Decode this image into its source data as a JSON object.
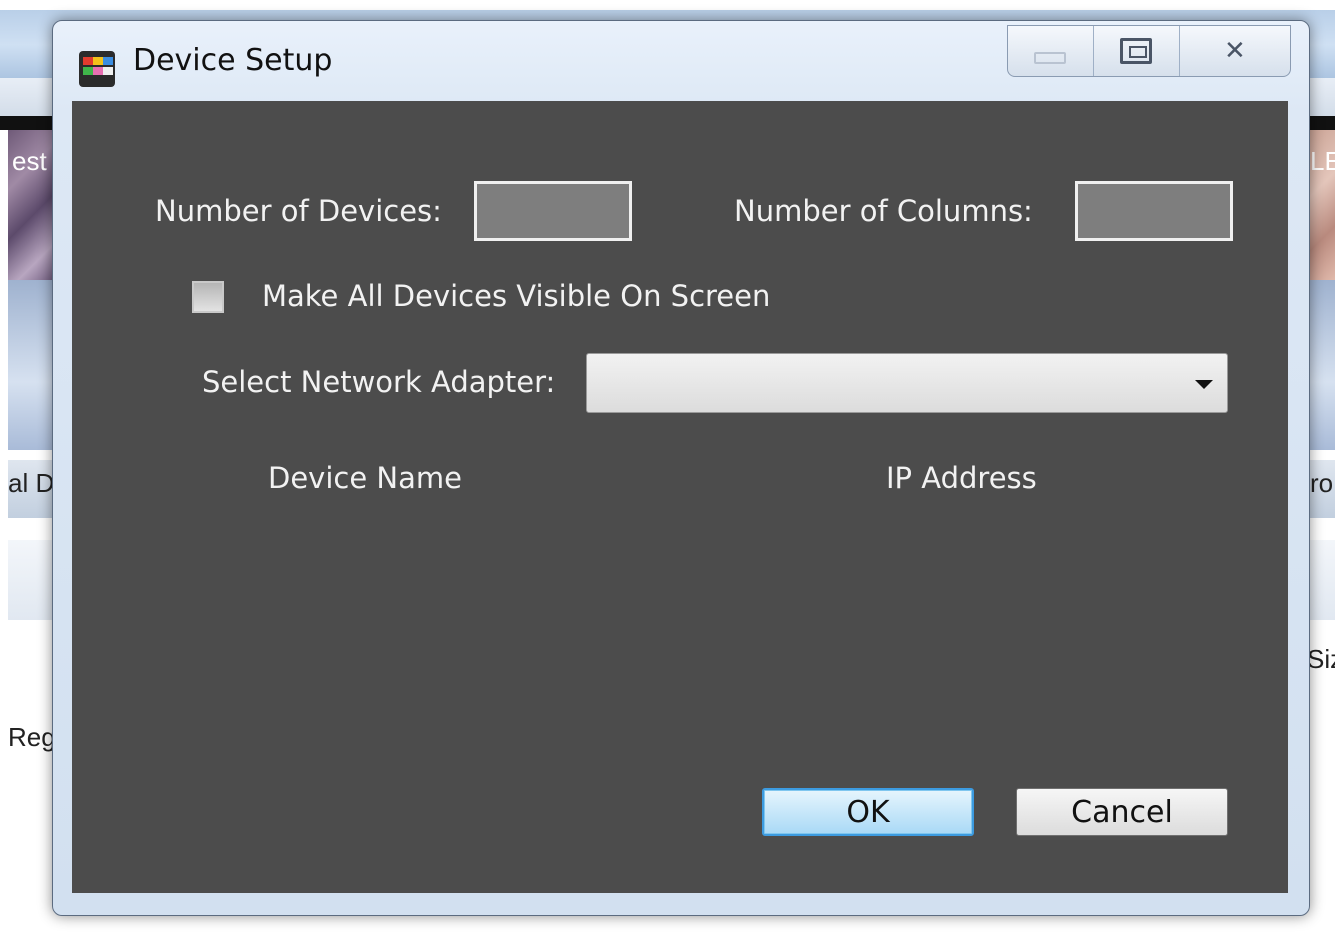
{
  "background": {
    "fragments": [
      "est",
      "al D",
      "Reg",
      "LE",
      "ro",
      "Siz"
    ]
  },
  "dialog": {
    "title": "Device Setup",
    "icon": "app-icon",
    "caption_buttons": [
      "minimize-icon",
      "maximize-icon",
      "close-icon"
    ],
    "close_glyph": "✕"
  },
  "form": {
    "num_devices_label": "Number of Devices:",
    "num_devices_value": "",
    "num_columns_label": "Number of Columns:",
    "num_columns_value": "",
    "visible_checkbox_label": "Make All Devices Visible On Screen",
    "visible_checked": false,
    "adapter_label": "Select Network Adapter:",
    "adapter_value": ""
  },
  "table": {
    "columns": [
      "Device Name",
      "IP Address"
    ],
    "rows": []
  },
  "buttons": {
    "ok": "OK",
    "cancel": "Cancel"
  }
}
